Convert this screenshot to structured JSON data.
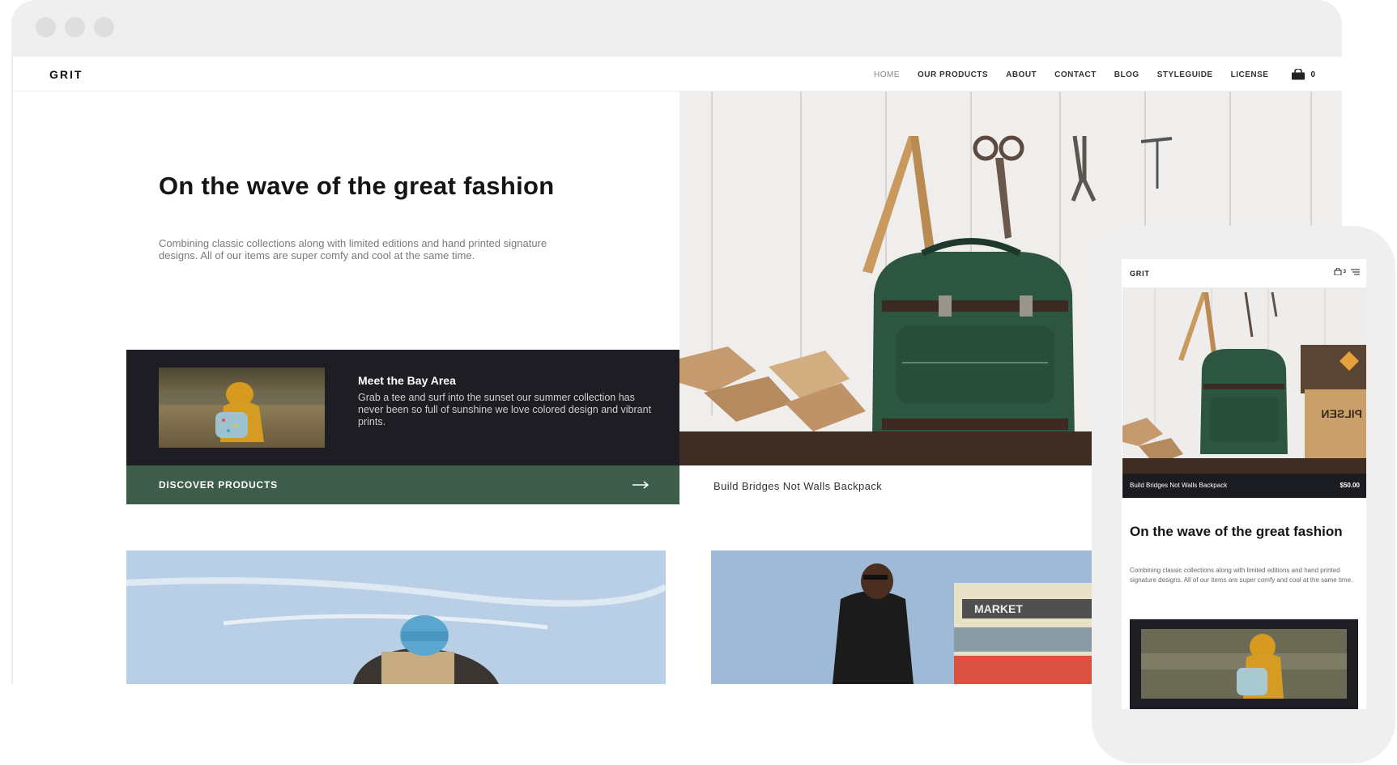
{
  "colors": {
    "accent_green": "#3e5e4b",
    "dark_panel": "#1d1d23",
    "frame_gray": "#efefef"
  },
  "desktop": {
    "logo": "GRIT",
    "nav": [
      {
        "label": "HOME",
        "active": true
      },
      {
        "label": "OUR PRODUCTS",
        "active": false
      },
      {
        "label": "ABOUT",
        "active": false
      },
      {
        "label": "CONTACT",
        "active": false
      },
      {
        "label": "BLOG",
        "active": false
      },
      {
        "label": "STYLEGUIDE",
        "active": false
      },
      {
        "label": "LICENSE",
        "active": false
      }
    ],
    "cart": {
      "icon": "shopping-bag-icon",
      "count": "0"
    },
    "hero": {
      "title": "On the wave of the great fashion",
      "description": "Combining classic collections along with limited editions and hand printed signature designs. All of our items are super comfy and cool at the same time."
    },
    "feature": {
      "title": "Meet the Bay Area",
      "text": "Grab a tee and surf into the sunset our summer collection has never been so full of sunshine we love colored design and vibrant prints."
    },
    "discover": {
      "label": "DISCOVER PRODUCTS",
      "icon": "arrow-right-icon"
    },
    "product_caption": "Build Bridges Not Walls Backpack"
  },
  "mobile": {
    "logo": "GRIT",
    "cart_count": "3",
    "icons": [
      "shopping-bag-icon",
      "hamburger-menu-icon"
    ],
    "product_name": "Build Bridges Not Walls Backpack",
    "product_price": "$50.00",
    "title": "On the wave of the great fashion",
    "description": "Combining classic collections along with limited editions and hand printed signature designs. All of our items are super comfy and cool at the same time."
  }
}
